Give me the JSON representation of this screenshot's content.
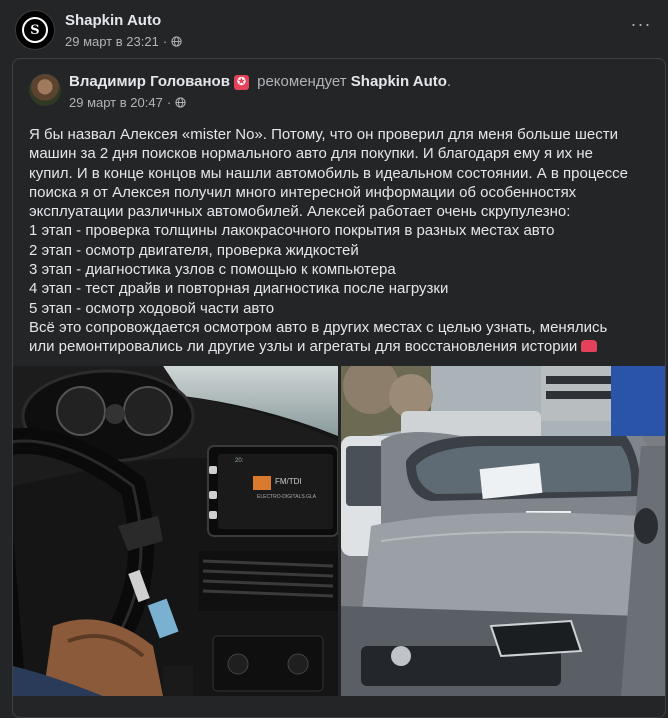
{
  "post": {
    "page_name": "Shapkin Auto",
    "timestamp": "29 март в 23:21",
    "more_label": "···",
    "logo_letter": "S"
  },
  "recommendation": {
    "author": "Владимир Голованов",
    "verb": "рекомендует",
    "page": "Shapkin Auto",
    "period": ".",
    "timestamp": "29 март в 20:47",
    "badge": "✪"
  },
  "review": {
    "lines": [
      "Я бы назвал Алексея «mister No». Потому, что он проверил для меня больше шести",
      "машин за 2 дня поисков нормального авто для покупки. И благодаря ему я их не",
      "купил. И в конце концов мы нашли автомобиль в идеальном состоянии. А в процессе",
      "поиска я от Алексея получил много интересной информации об особенностях",
      "эксплуатации различных автомобилей. Алексей работает очень скрупулезно:",
      "1 этап - проверка толщины лакокрасочного покрытия в разных местах авто",
      "2 этап - осмотр двигателя, проверка жидкостей",
      "3 этап - диагностика узлов с помощью к компьютера",
      "4 этап - тест драйв и повторная диагностика после нагрузки",
      "5 этап - осмотр ходовой части авто",
      "Всё это сопровождается осмотром авто в других местах с целью узнать, менялись",
      "или ремонтировались ли другие узлы и агрегаты для восстановления истории"
    ]
  },
  "photos": {
    "left": {
      "screen_time": "20:",
      "screen_station": "FM/TDI",
      "screen_sub": "ELECTRO-DIGITALS.GLA"
    },
    "right": {}
  },
  "colors": {
    "background": "#242526",
    "text_primary": "#e4e6eb",
    "text_secondary": "#b0b3b8",
    "badge": "#e4415a"
  },
  "icons": [
    "globe-icon",
    "more-icon",
    "star-badge-icon",
    "car-emoji-icon"
  ]
}
